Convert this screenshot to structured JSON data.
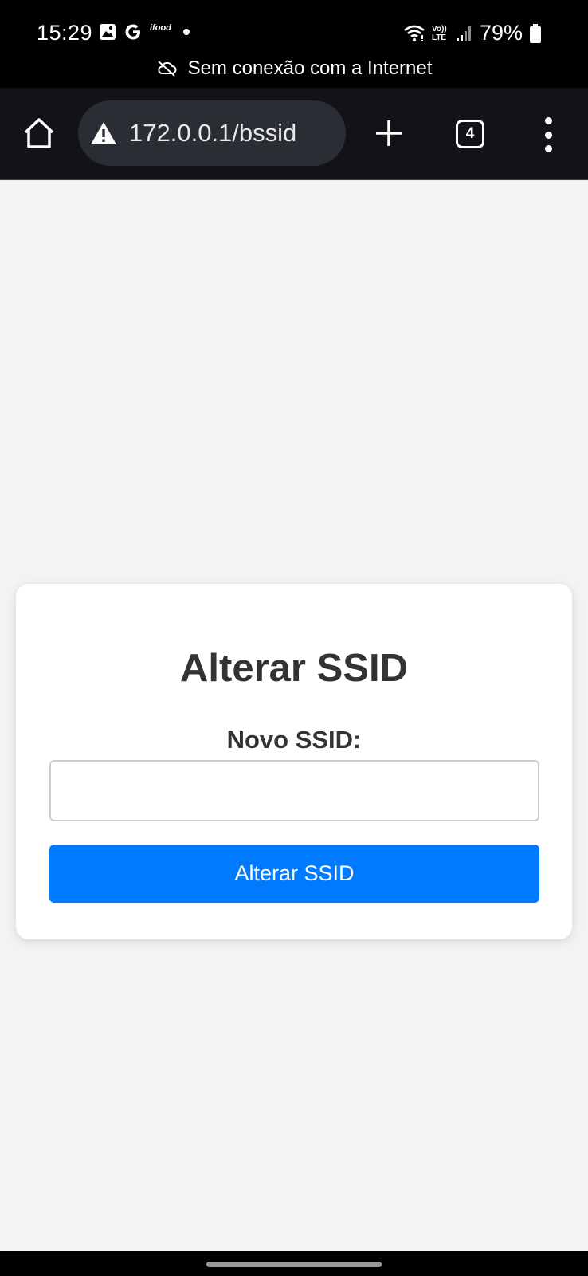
{
  "status_bar": {
    "time": "15:29",
    "battery": "79%",
    "network_message": "Sem conexão com a Internet",
    "left_icons": [
      "image-icon",
      "google-icon",
      "ifood-icon",
      "dot-icon"
    ],
    "right_icons": [
      "wifi-icon",
      "volte-icon",
      "signal-icon",
      "battery-icon"
    ],
    "ifood_text": "ifood",
    "volte_text": "Vo)) LTE"
  },
  "browser": {
    "url": "172.0.0.1/bssid",
    "tab_count": "4"
  },
  "form": {
    "title": "Alterar SSID",
    "label": "Novo SSID:",
    "input_value": "",
    "input_placeholder": "",
    "button_label": "Alterar SSID"
  },
  "colors": {
    "button": "#007bff",
    "page_bg": "#f3f3f3",
    "toolbar_bg": "#121316"
  }
}
